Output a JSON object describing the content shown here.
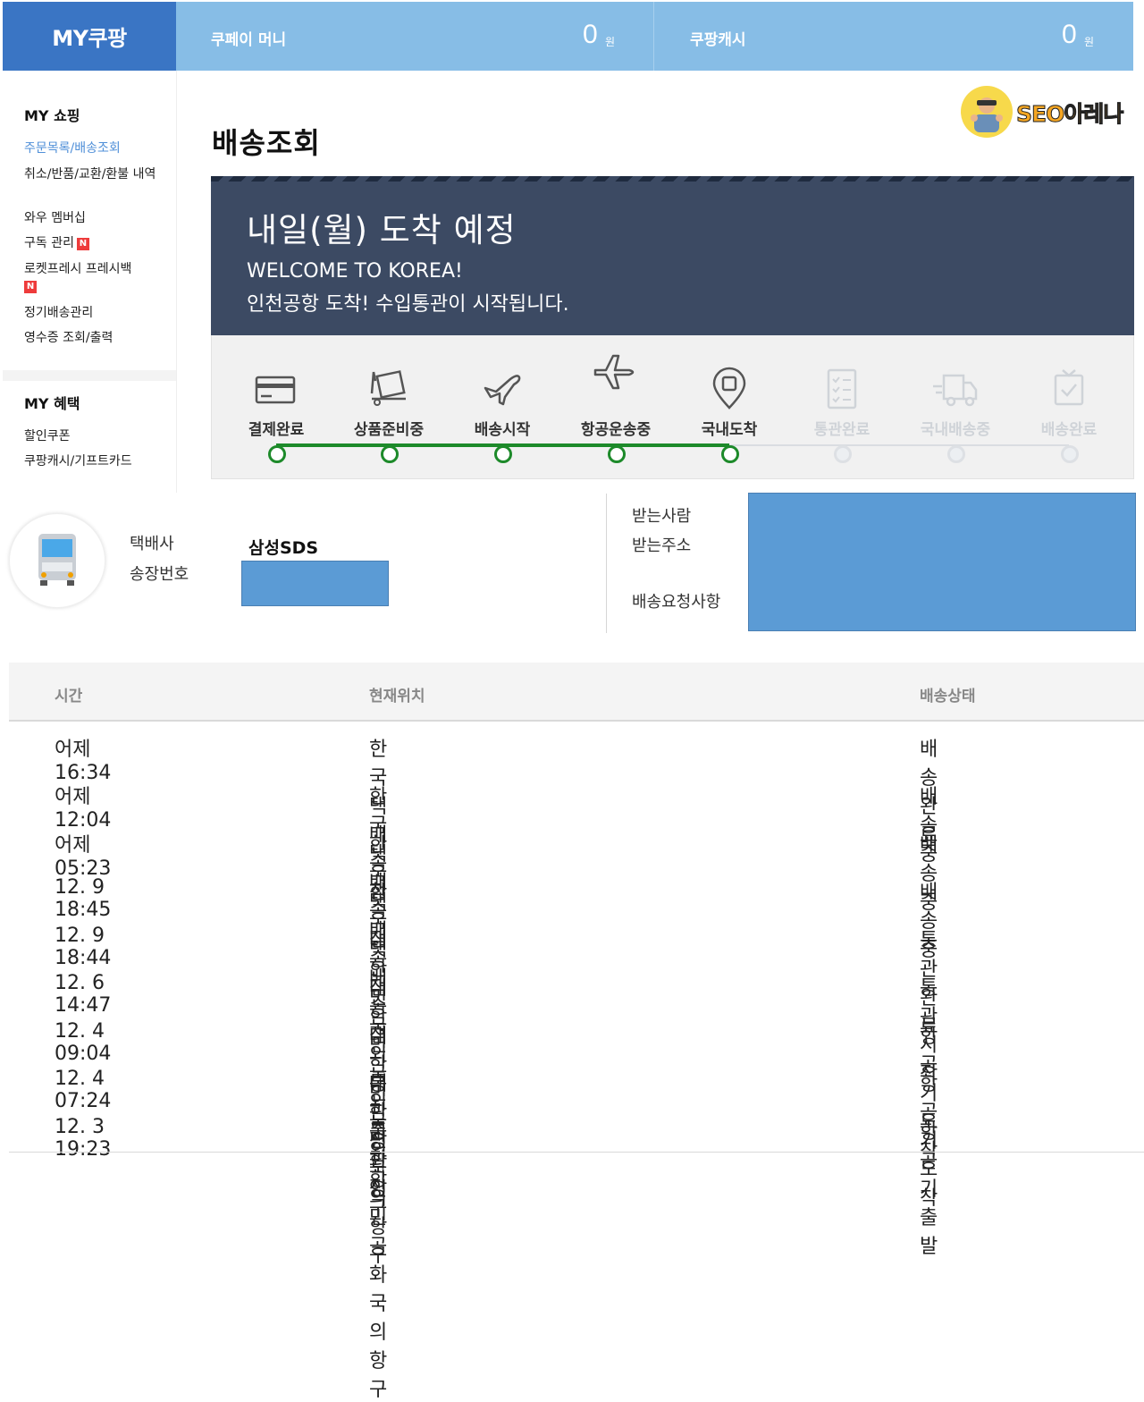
{
  "header": {
    "brand": "MY쿠팡",
    "coupay_label": "쿠페이 머니",
    "coupay_amount": "0",
    "coupay_unit": "원",
    "cash_label": "쿠팡캐시",
    "cash_amount": "0",
    "cash_unit": "원"
  },
  "sidebar": {
    "shopping_title": "MY 쇼핑",
    "shopping_items": [
      {
        "label": "주문목록/배송조회"
      },
      {
        "label": "취소/반품/교환/환불 내역"
      },
      {
        "label": "와우 멤버십"
      },
      {
        "label": "구독 관리"
      },
      {
        "label": "로켓프레시 프레시백"
      },
      {
        "label": "정기배송관리"
      },
      {
        "label": "영수증 조회/출력"
      }
    ],
    "new_badge": "N",
    "benefit_title": "MY 혜택",
    "benefit_items": [
      {
        "label": "할인쿠폰"
      },
      {
        "label": "쿠팡캐시/기프트카드"
      }
    ]
  },
  "page_title": "배송조회",
  "logo_text": "SEO아레나",
  "banner": {
    "title": "내일(월) 도착 예정",
    "line1": "WELCOME TO KOREA!",
    "line2": "인천공항 도착! 수입통관이 시작됩니다."
  },
  "steps": [
    {
      "label": "결제완료",
      "icon": "card-icon",
      "done": true
    },
    {
      "label": "상품준비중",
      "icon": "box-icon",
      "done": true
    },
    {
      "label": "배송시작",
      "icon": "takeoff-icon",
      "done": true
    },
    {
      "label": "항공운송중",
      "icon": "airplane-icon",
      "done": true
    },
    {
      "label": "국내도착",
      "icon": "location-pin-icon",
      "done": true
    },
    {
      "label": "통관완료",
      "icon": "checklist-icon",
      "done": false
    },
    {
      "label": "국내배송중",
      "icon": "truck-icon",
      "done": false
    },
    {
      "label": "배송완료",
      "icon": "package-check-icon",
      "done": false
    }
  ],
  "courier": {
    "courier_label": "택배사",
    "tracking_label": "송장번호",
    "courier_name": "삼성SDS"
  },
  "recipient": {
    "name_label": "받는사람",
    "address_label": "받는주소",
    "request_label": "배송요청사항"
  },
  "table": {
    "headers": [
      "시간",
      "현재위치",
      "배송상태"
    ],
    "rows": [
      [
        "어제 16:34",
        "한국택배송점",
        "배송완료"
      ],
      [
        "어제 12:04",
        "한국택배송점",
        "배송중"
      ],
      [
        "어제 05:23",
        "한국택배송점",
        "배송중"
      ],
      [
        "12. 9 18:45",
        "한국택배송점",
        "배송중"
      ],
      [
        "12. 9 18:44",
        "대한민국의 통관장",
        "통관완료"
      ],
      [
        "12. 6 14:47",
        "대한민국의 통관장",
        "통관시작"
      ],
      [
        "12. 4 09:04",
        "대한민국의 항구",
        "항공기 도착"
      ],
      [
        "12. 4 07:24",
        "대한민국의 항구",
        "항공기 도착"
      ],
      [
        "12. 3 19:23",
        "중화인민공화국의 항구",
        "항공기 출발"
      ]
    ]
  },
  "colors": {
    "brand_blue": "#3a75c4",
    "topbar_blue": "#87bde6",
    "banner_navy": "#3c4a63",
    "progress_green": "#1d8a2a",
    "redaction_blue": "#5b9bd5"
  }
}
